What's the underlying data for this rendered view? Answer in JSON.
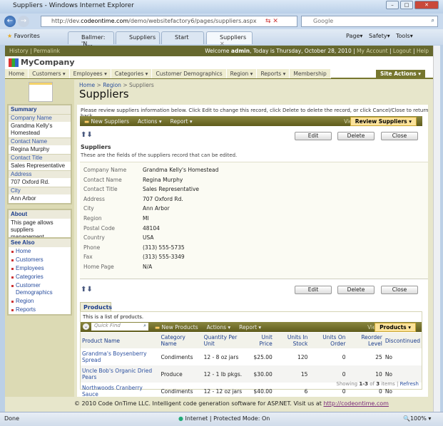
{
  "window": {
    "title": "Suppliers - Windows Internet Explorer"
  },
  "browser": {
    "url_prefix": "http://dev.",
    "url_domain": "codeontime.com",
    "url_path": "/demo/websitefactory6/pages/suppliers.aspx",
    "search_placeholder": "Google",
    "favorites": "Favorites",
    "tabs": [
      "Ballmer: 'N...",
      "Suppliers",
      "Start",
      "Suppliers"
    ],
    "commands": [
      "Page",
      "Safety",
      "Tools"
    ]
  },
  "topbar": {
    "history": "History",
    "permalink": "Permalink",
    "welcome": "Welcome ",
    "user": "admin",
    "date": ", Today is Thursday, October 28, 2010",
    "my_account": "My Account",
    "logout": "Logout",
    "help": "Help"
  },
  "brand": "MyCompany",
  "menu": [
    "Home",
    "Customers ▾",
    "Employees ▾",
    "Categories ▾",
    "Customer Demographics",
    "Region ▾",
    "Reports ▾",
    "Membership"
  ],
  "site_actions": "Site Actions ▾",
  "sidebar": {
    "summary_title": "Summary",
    "summary": [
      {
        "label": "Company Name",
        "value": "Grandma Kelly's Homestead"
      },
      {
        "label": "Contact Name",
        "value": "Regina Murphy"
      },
      {
        "label": "Contact Title",
        "value": "Sales Representative"
      },
      {
        "label": "Address",
        "value": "707 Oxford Rd."
      },
      {
        "label": "City",
        "value": "Ann Arbor"
      }
    ],
    "about_title": "About",
    "about_text": "This page allows suppliers management.",
    "see_also_title": "See Also",
    "see_also": [
      "Home",
      "Customers",
      "Employees",
      "Categories",
      "Customer Demographics",
      "Region",
      "Reports"
    ]
  },
  "breadcrumb": [
    "Home",
    "Region",
    "Suppliers"
  ],
  "page_title": "Suppliers",
  "instructions": "Please review suppliers information below. Click Edit to change this record, click Delete to delete the record, or click Cancel/Close to return back.",
  "toolbar": {
    "new": "New Suppliers",
    "actions": "Actions ▾",
    "report": "Report ▾",
    "view_label": "View:",
    "view": "Review Suppliers ▾"
  },
  "buttons": {
    "edit": "Edit",
    "delete": "Delete",
    "close": "Close"
  },
  "form": {
    "title": "Suppliers",
    "description": "These are the fields of the suppliers record that can be edited.",
    "fields": [
      {
        "label": "Company Name",
        "value": "Grandma Kelly's Homestead"
      },
      {
        "label": "Contact Name",
        "value": "Regina Murphy"
      },
      {
        "label": "Contact Title",
        "value": "Sales Representative"
      },
      {
        "label": "Address",
        "value": "707 Oxford Rd."
      },
      {
        "label": "City",
        "value": "Ann Arbor"
      },
      {
        "label": "Region",
        "value": "MI"
      },
      {
        "label": "Postal Code",
        "value": "48104"
      },
      {
        "label": "Country",
        "value": "USA"
      },
      {
        "label": "Phone",
        "value": "(313) 555-5735"
      },
      {
        "label": "Fax",
        "value": "(313) 555-3349"
      },
      {
        "label": "Home Page",
        "value": "N/A"
      }
    ]
  },
  "products": {
    "tab": "Products",
    "description": "This is a list of products.",
    "quick_find": "Quick Find",
    "new": "New Products",
    "actions": "Actions ▾",
    "report": "Report ▾",
    "view_label": "View:",
    "view": "Products ▾",
    "columns": [
      "Product Name",
      "Category Name",
      "Quantity Per Unit",
      "Unit Price",
      "Units In Stock",
      "Units On Order",
      "Reorder Level",
      "Discontinued"
    ],
    "rows": [
      [
        "Grandma's Boysenberry Spread",
        "Condiments",
        "12 - 8 oz jars",
        "$25.00",
        "120",
        "0",
        "25",
        "No"
      ],
      [
        "Uncle Bob's Organic Dried Pears",
        "Produce",
        "12 - 1 lb pkgs.",
        "$30.00",
        "15",
        "0",
        "10",
        "No"
      ],
      [
        "Northwoods Cranberry Sauce",
        "Condiments",
        "12 - 12 oz jars",
        "$40.00",
        "6",
        "0",
        "0",
        "No"
      ]
    ],
    "showing_prefix": "Showing ",
    "showing_range": "1-3",
    "showing_of": " of ",
    "showing_total": "3",
    "showing_suffix": " items | ",
    "refresh": "Refresh"
  },
  "footer": {
    "text": "© 2010 Code OnTime LLC. Intelligent code generation software for ASP.NET. Visit us at ",
    "link": "http://codeontime.com"
  },
  "status": {
    "left": "Done",
    "zone": "Internet | Protected Mode: On",
    "zoom": "100%"
  }
}
